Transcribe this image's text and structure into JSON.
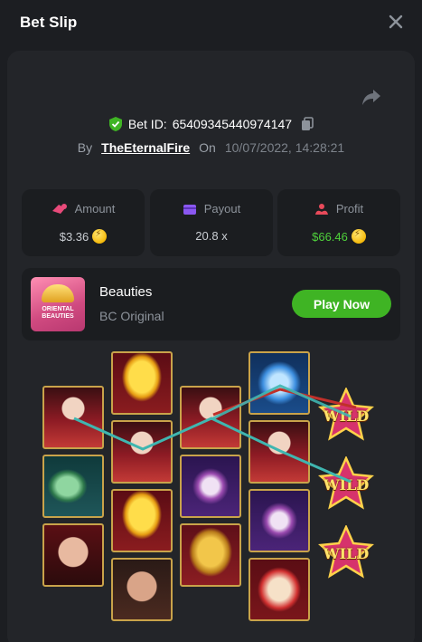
{
  "header": {
    "title": "Bet Slip"
  },
  "bet": {
    "id_label": "Bet ID:",
    "id_value": "65409345440974147",
    "by_label": "By",
    "username": "TheEternalFire",
    "on_label": "On",
    "datetime": "10/07/2022, 14:28:21"
  },
  "stats": [
    {
      "label": "Amount",
      "value": "$3.36",
      "coin": true,
      "color": "#c9cdd2",
      "icon": "amount-icon"
    },
    {
      "label": "Payout",
      "value": "20.8 x",
      "coin": false,
      "color": "#c9cdd2",
      "icon": "payout-icon"
    },
    {
      "label": "Profit",
      "value": "$66.46",
      "coin": true,
      "color": "#4fd13b",
      "icon": "profit-icon"
    }
  ],
  "game": {
    "thumb_text": "ORIENTAL BEAUTIES",
    "name": "Beauties",
    "provider": "BC Original",
    "play_label": "Play Now"
  },
  "reels": {
    "wild_label": "WILD",
    "columns": [
      [
        "lady",
        "jade",
        "nude"
      ],
      [
        "gold",
        "lady",
        "gold",
        "nude2"
      ],
      [
        "lady",
        "flower",
        "comb"
      ],
      [
        "blue",
        "lady",
        "flower",
        "fanred"
      ],
      [
        "wild",
        "wild",
        "wild"
      ]
    ]
  },
  "colors": {
    "accent_green": "#3fb424",
    "profit_green": "#4fd13b",
    "frame_gold": "#c9a34a",
    "line_teal": "#3fb6b0",
    "line_red": "#c0302a"
  }
}
